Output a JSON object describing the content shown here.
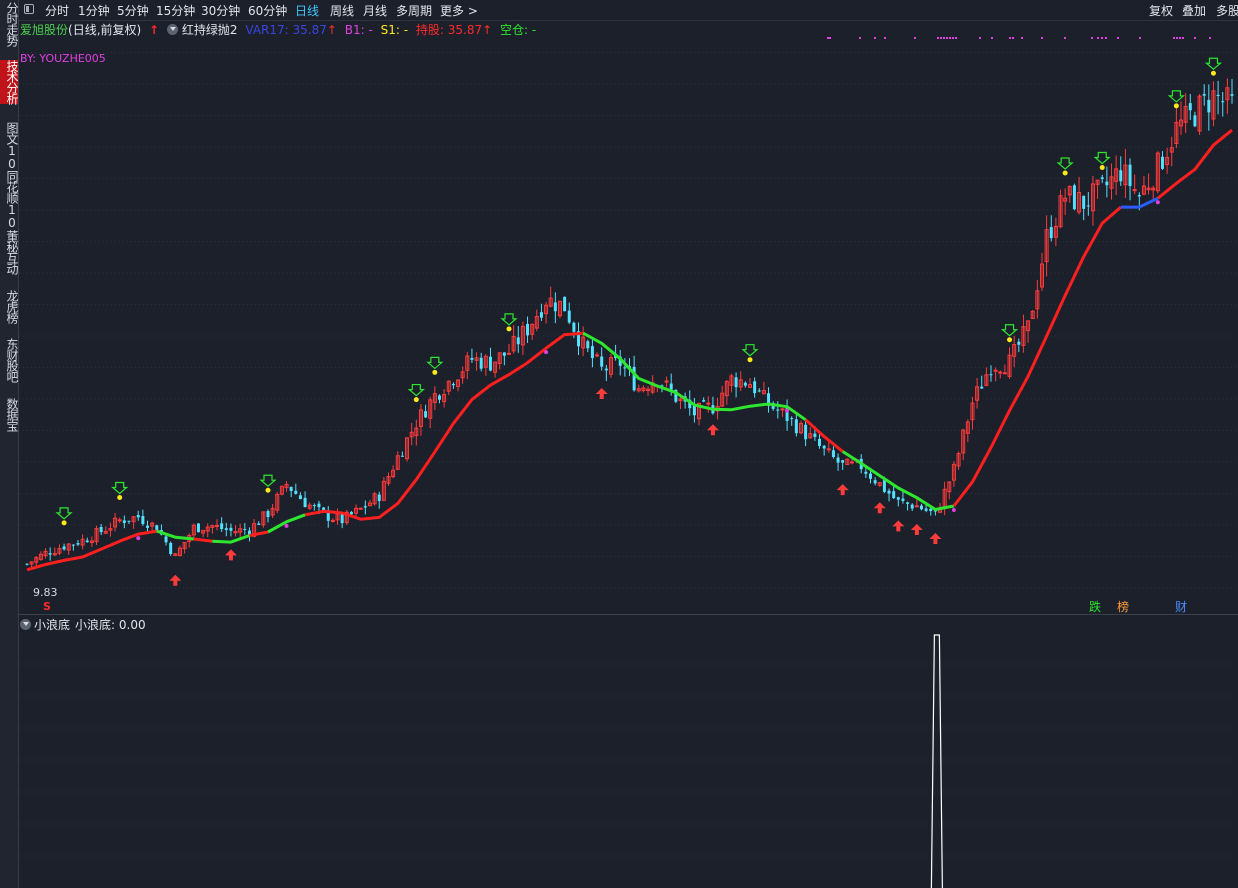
{
  "sidebar": {
    "tabs": [
      {
        "label": "分时走势",
        "active": false
      },
      {
        "label": "技术分析",
        "active": true
      },
      {
        "label": "图文10",
        "active": false
      },
      {
        "label": "同花顺10",
        "active": false
      },
      {
        "label": "董秘互动",
        "active": false
      },
      {
        "label": "龙虎榜",
        "active": false
      },
      {
        "label": "东财股吧",
        "active": false
      },
      {
        "label": "数据宝",
        "active": false
      }
    ]
  },
  "toolbar": {
    "periods": [
      "分时",
      "1分钟",
      "5分钟",
      "15分钟",
      "30分钟",
      "60分钟",
      "日线",
      "周线",
      "月线",
      "多周期",
      "更多 >"
    ],
    "active_period": "日线",
    "right_buttons": [
      "复权",
      "叠加",
      "多股"
    ]
  },
  "info": {
    "stock_name": "爱旭股份",
    "mode": "(日线,前复权)",
    "indicator_name": "红持绿抛2",
    "var_label": "VAR17: 35.87",
    "b1": "B1: -",
    "s1": "S1: -",
    "hold": "持股: 35.87",
    "empty": "空仓: -",
    "watermark": "BY: YOUZHE005",
    "low_price": "9.83",
    "buy_mark": "S",
    "badges": [
      "跌",
      "榜",
      "财"
    ]
  },
  "sub_indicator": {
    "name": "小浪底",
    "value_label": "小浪底: 0.00"
  },
  "colors": {
    "up": "#ff3b3b",
    "down": "#54e0ff",
    "line_red": "#ff1f1f",
    "line_green": "#2ee62e",
    "line_blue": "#2a5cff",
    "magenta": "#e040e0",
    "yellow": "#ffe81a"
  },
  "chart_data": {
    "type": "candlestick",
    "close_approx": [
      10.6,
      11.2,
      11.6,
      11.9,
      12.4,
      13.0,
      13.2,
      12.6,
      11.0,
      12.6,
      12.7,
      12.4,
      12.5,
      13.4,
      15.0,
      14.0,
      13.3,
      13.0,
      13.6,
      14.4,
      16.5,
      18.4,
      19.9,
      20.9,
      21.9,
      21.7,
      22.3,
      23.6,
      25.2,
      24.8,
      22.6,
      21.3,
      21.7,
      20.3,
      20.9,
      19.8,
      18.9,
      19.3,
      20.8,
      20.6,
      19.4,
      18.7,
      17.8,
      16.8,
      16.0,
      16.0,
      15.0,
      14.0,
      13.8,
      13.3,
      15.8,
      19.5,
      21.6,
      21.7,
      23.6,
      28.6,
      30.9,
      30.5,
      31.2,
      32.3,
      30.9,
      32.5,
      34.6,
      35.5,
      36.4,
      35.9
    ],
    "trend_line_segments": [
      {
        "color": "red",
        "from": 0,
        "to": 7
      },
      {
        "color": "green",
        "from": 7,
        "to": 9
      },
      {
        "color": "red",
        "from": 9,
        "to": 10
      },
      {
        "color": "green",
        "from": 10,
        "to": 12
      },
      {
        "color": "red",
        "from": 12,
        "to": 13
      },
      {
        "color": "green",
        "from": 13,
        "to": 15
      },
      {
        "color": "red",
        "from": 15,
        "to": 30
      },
      {
        "color": "green",
        "from": 30,
        "to": 42
      },
      {
        "color": "red",
        "from": 42,
        "to": 44
      },
      {
        "color": "green",
        "from": 44,
        "to": 50
      },
      {
        "color": "red",
        "from": 50,
        "to": 59
      },
      {
        "color": "blue",
        "from": 59,
        "to": 61
      },
      {
        "color": "red",
        "from": 61,
        "to": 65
      }
    ],
    "sub_series": {
      "name": "小浪底",
      "spike_index": 49,
      "spike_value": 1,
      "baseline": 0
    }
  }
}
